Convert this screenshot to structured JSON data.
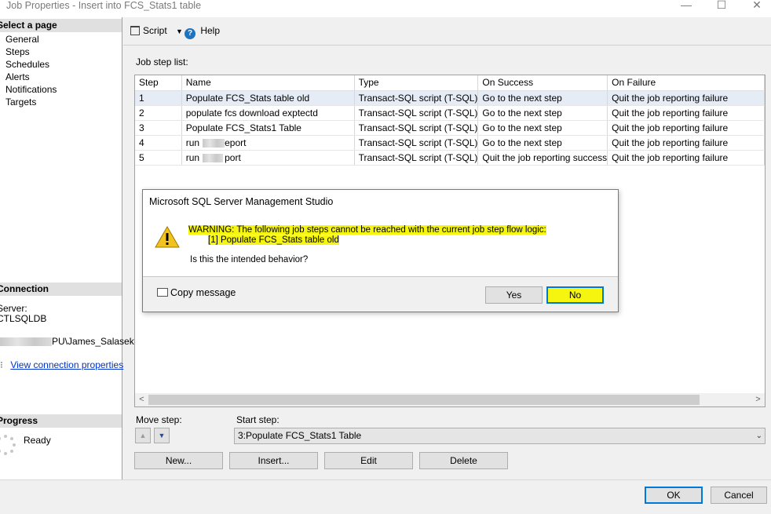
{
  "window": {
    "title": "Job Properties - Insert into FCS_Stats1 table",
    "controls": [
      "—",
      "☐",
      "✕"
    ]
  },
  "sidebar": {
    "select_header": "Select a page",
    "pages": [
      "General",
      "Steps",
      "Schedules",
      "Alerts",
      "Notifications",
      "Targets"
    ],
    "connection_header": "Connection",
    "server_label": "Server:",
    "server_value": "CTLSQLDB",
    "connection_value": "PU\\James_Salasek",
    "view_connection_link": "View connection properties",
    "progress_header": "Progress",
    "progress_status": "Ready"
  },
  "toolbar": {
    "script_label": "Script",
    "help_label": "Help"
  },
  "steps": {
    "list_label": "Job step list:",
    "columns": [
      "Step",
      "Name",
      "Type",
      "On Success",
      "On Failure"
    ],
    "rows": [
      [
        "1",
        "Populate FCS_Stats table old",
        "Transact-SQL script (T-SQL)",
        "Go to the next step",
        "Quit the job reporting failure"
      ],
      [
        "2",
        "populate fcs download exptectd",
        "Transact-SQL script (T-SQL)",
        "Go to the next step",
        "Quit the job reporting failure"
      ],
      [
        "3",
        "Populate FCS_Stats1 Table",
        "Transact-SQL script (T-SQL)",
        "Go to the next step",
        "Quit the job reporting failure"
      ],
      [
        "4",
        "run C      eport",
        "Transact-SQL script (T-SQL)",
        "Go to the next step",
        "Quit the job reporting failure"
      ],
      [
        "5",
        "run C      port",
        "Transact-SQL script (T-SQL)",
        "Quit the job reporting success",
        "Quit the job reporting failure"
      ]
    ],
    "move_step_label": "Move step:",
    "start_step_label": "Start step:",
    "start_step_value": "3:Populate FCS_Stats1 Table",
    "buttons": {
      "new": "New...",
      "insert": "Insert...",
      "edit": "Edit",
      "delete": "Delete"
    }
  },
  "dialog": {
    "title": "Microsoft SQL Server Management Studio",
    "warning_line": "WARNING: The following job steps cannot be reached with the current job step flow logic:",
    "step_line": "[1] Populate FCS_Stats table old",
    "question": "Is this the intended behavior?",
    "copy_message": "Copy message",
    "yes": "Yes",
    "no": "No",
    "highlight_color": "#f5f50f"
  },
  "footer": {
    "ok": "OK",
    "cancel": "Cancel"
  }
}
